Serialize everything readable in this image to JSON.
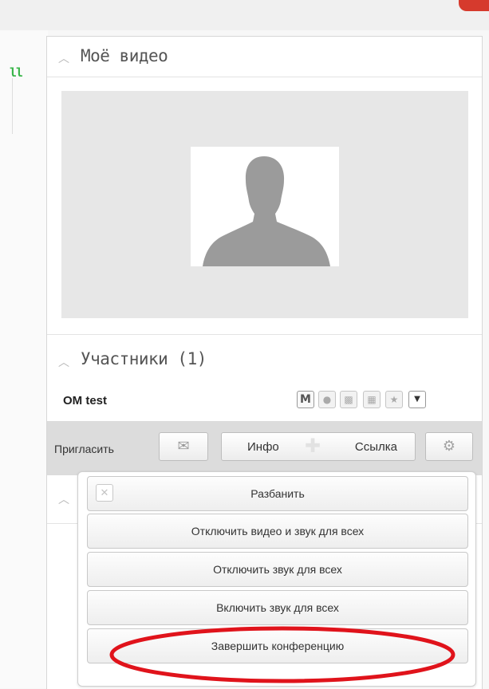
{
  "colors": {
    "accent_red": "#d63a2d",
    "highlight_ellipse": "#e0131b",
    "status_green": "#3ab54a"
  },
  "sidebar": {
    "status_bars": "ll"
  },
  "panel": {
    "my_video": {
      "title": "Моё видео"
    },
    "participants": {
      "title": "Участники (1)",
      "rows": [
        {
          "name": "OM test",
          "icons": [
            "moderator-icon",
            "microphone-icon",
            "signal-icon",
            "camera-icon",
            "star-icon",
            "dropdown-icon"
          ],
          "moderator_label": "M"
        }
      ]
    },
    "invite_bar": {
      "label": "Пригласить",
      "info_label": "Инфо",
      "link_label": "Ссылка"
    }
  },
  "menu": {
    "items": [
      {
        "label": "Разбанить"
      },
      {
        "label": "Отключить видео и звук для всех"
      },
      {
        "label": "Отключить звук для всех"
      },
      {
        "label": "Включить звук для всех"
      },
      {
        "label": "Завершить конференцию"
      }
    ]
  }
}
